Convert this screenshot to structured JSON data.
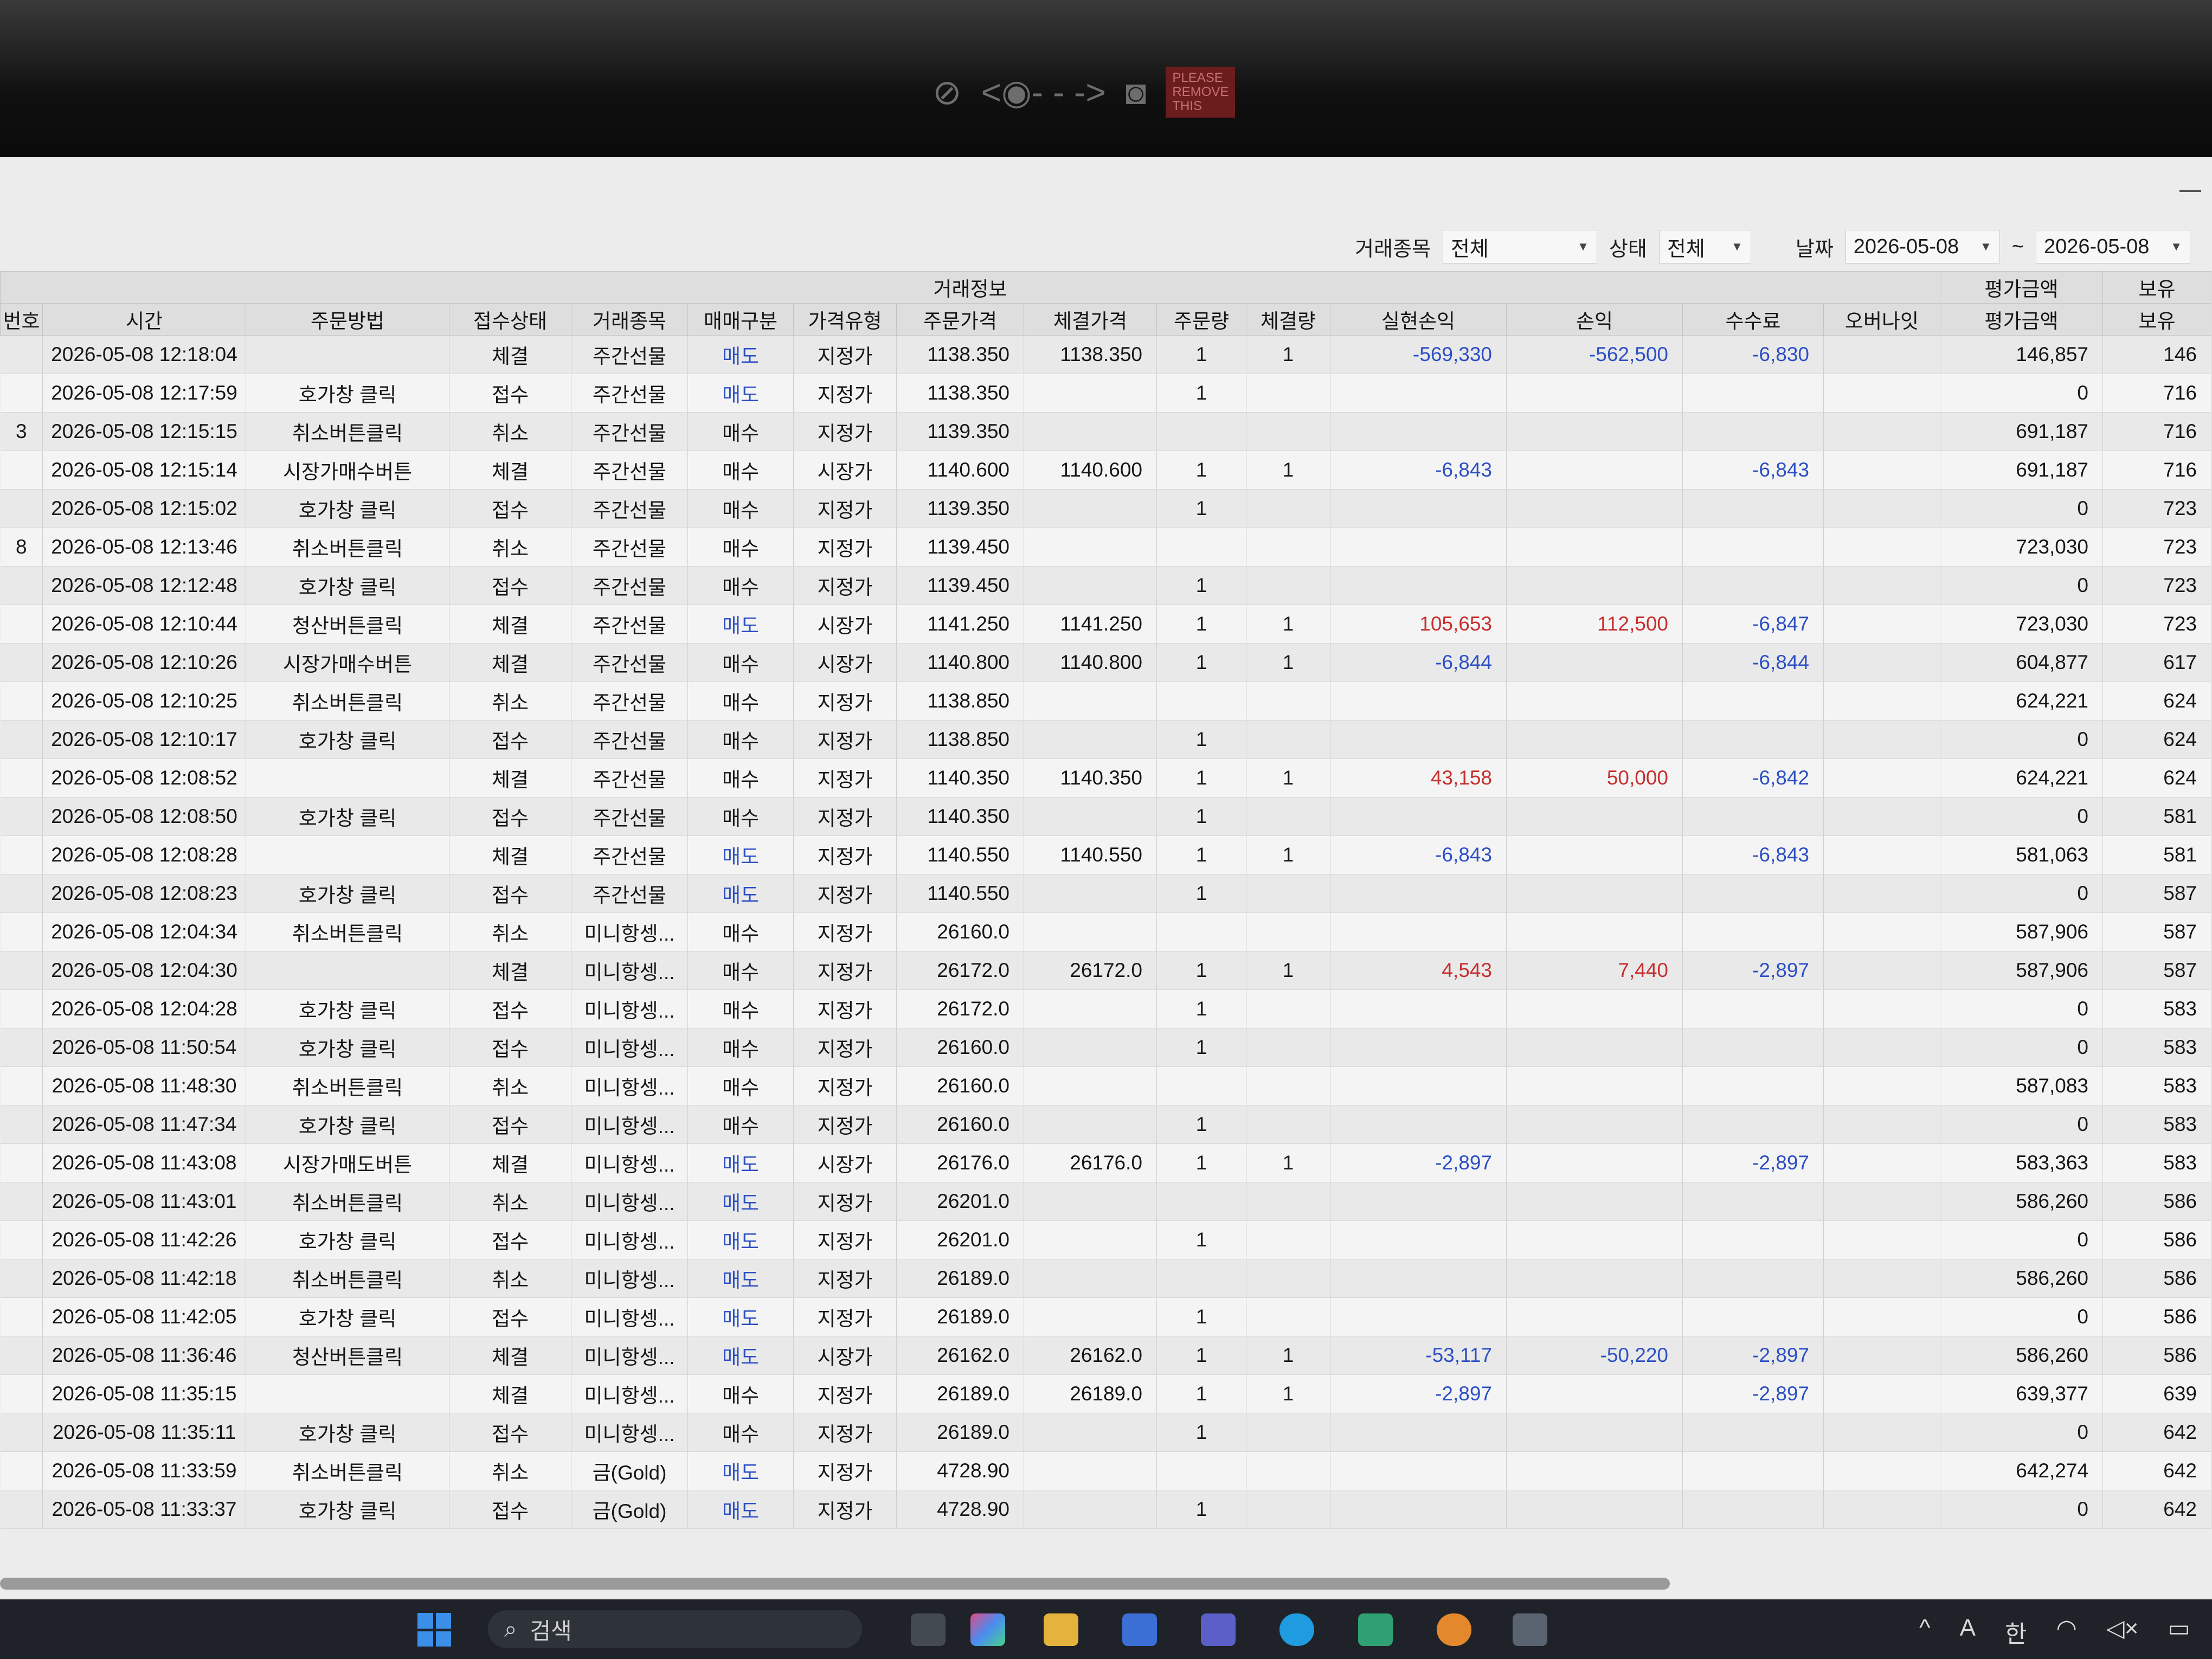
{
  "overlay": {
    "badge": "PLEASE\nREMOVE\nTHIS"
  },
  "filters": {
    "symbol_label": "거래종목",
    "symbol_value": "전체",
    "status_label": "상태",
    "status_value": "전체",
    "date_label": "날짜",
    "date_from": "2026-05-08",
    "date_sep": "~",
    "date_to": "2026-05-08"
  },
  "table": {
    "group_header": "거래정보",
    "right_group_header": "평가금액",
    "cut_group_header": "보유",
    "columns": [
      "번호",
      "시간",
      "주문방법",
      "접수상태",
      "거래종목",
      "매매구분",
      "가격유형",
      "주문가격",
      "체결가격",
      "주문량",
      "체결량",
      "실현손익",
      "손익",
      "수수료",
      "오버나잇",
      "평가금액",
      "보유"
    ],
    "rows": [
      [
        "",
        "2026-05-08 12:18:04",
        "",
        "체결",
        "주간선물",
        "매도",
        "지정가",
        "1138.350",
        "1138.350",
        "1",
        "1",
        "-569,330",
        "-562,500",
        "-6,830",
        "",
        "146,857",
        "146"
      ],
      [
        "",
        "2026-05-08 12:17:59",
        "호가창 클릭",
        "접수",
        "주간선물",
        "매도",
        "지정가",
        "1138.350",
        "",
        "1",
        "",
        "",
        "",
        "",
        "",
        "0",
        "716"
      ],
      [
        "3",
        "2026-05-08 12:15:15",
        "취소버튼클릭",
        "취소",
        "주간선물",
        "매수",
        "지정가",
        "1139.350",
        "",
        "",
        "",
        "",
        "",
        "",
        "",
        "691,187",
        "716"
      ],
      [
        "",
        "2026-05-08 12:15:14",
        "시장가매수버튼",
        "체결",
        "주간선물",
        "매수",
        "시장가",
        "1140.600",
        "1140.600",
        "1",
        "1",
        "-6,843",
        "",
        "-6,843",
        "",
        "691,187",
        "716"
      ],
      [
        "",
        "2026-05-08 12:15:02",
        "호가창 클릭",
        "접수",
        "주간선물",
        "매수",
        "지정가",
        "1139.350",
        "",
        "1",
        "",
        "",
        "",
        "",
        "",
        "0",
        "723"
      ],
      [
        "8",
        "2026-05-08 12:13:46",
        "취소버튼클릭",
        "취소",
        "주간선물",
        "매수",
        "지정가",
        "1139.450",
        "",
        "",
        "",
        "",
        "",
        "",
        "",
        "723,030",
        "723"
      ],
      [
        "",
        "2026-05-08 12:12:48",
        "호가창 클릭",
        "접수",
        "주간선물",
        "매수",
        "지정가",
        "1139.450",
        "",
        "1",
        "",
        "",
        "",
        "",
        "",
        "0",
        "723"
      ],
      [
        "",
        "2026-05-08 12:10:44",
        "청산버튼클릭",
        "체결",
        "주간선물",
        "매도",
        "시장가",
        "1141.250",
        "1141.250",
        "1",
        "1",
        "105,653",
        "112,500",
        "-6,847",
        "",
        "723,030",
        "723"
      ],
      [
        "",
        "2026-05-08 12:10:26",
        "시장가매수버튼",
        "체결",
        "주간선물",
        "매수",
        "시장가",
        "1140.800",
        "1140.800",
        "1",
        "1",
        "-6,844",
        "",
        "-6,844",
        "",
        "604,877",
        "617"
      ],
      [
        "",
        "2026-05-08 12:10:25",
        "취소버튼클릭",
        "취소",
        "주간선물",
        "매수",
        "지정가",
        "1138.850",
        "",
        "",
        "",
        "",
        "",
        "",
        "",
        "624,221",
        "624"
      ],
      [
        "",
        "2026-05-08 12:10:17",
        "호가창 클릭",
        "접수",
        "주간선물",
        "매수",
        "지정가",
        "1138.850",
        "",
        "1",
        "",
        "",
        "",
        "",
        "",
        "0",
        "624"
      ],
      [
        "",
        "2026-05-08 12:08:52",
        "",
        "체결",
        "주간선물",
        "매수",
        "지정가",
        "1140.350",
        "1140.350",
        "1",
        "1",
        "43,158",
        "50,000",
        "-6,842",
        "",
        "624,221",
        "624"
      ],
      [
        "",
        "2026-05-08 12:08:50",
        "호가창 클릭",
        "접수",
        "주간선물",
        "매수",
        "지정가",
        "1140.350",
        "",
        "1",
        "",
        "",
        "",
        "",
        "",
        "0",
        "581"
      ],
      [
        "",
        "2026-05-08 12:08:28",
        "",
        "체결",
        "주간선물",
        "매도",
        "지정가",
        "1140.550",
        "1140.550",
        "1",
        "1",
        "-6,843",
        "",
        "-6,843",
        "",
        "581,063",
        "581"
      ],
      [
        "",
        "2026-05-08 12:08:23",
        "호가창 클릭",
        "접수",
        "주간선물",
        "매도",
        "지정가",
        "1140.550",
        "",
        "1",
        "",
        "",
        "",
        "",
        "",
        "0",
        "587"
      ],
      [
        "",
        "2026-05-08 12:04:34",
        "취소버튼클릭",
        "취소",
        "미니항셍...",
        "매수",
        "지정가",
        "26160.0",
        "",
        "",
        "",
        "",
        "",
        "",
        "",
        "587,906",
        "587"
      ],
      [
        "",
        "2026-05-08 12:04:30",
        "",
        "체결",
        "미니항셍...",
        "매수",
        "지정가",
        "26172.0",
        "26172.0",
        "1",
        "1",
        "4,543",
        "7,440",
        "-2,897",
        "",
        "587,906",
        "587"
      ],
      [
        "",
        "2026-05-08 12:04:28",
        "호가창 클릭",
        "접수",
        "미니항셍...",
        "매수",
        "지정가",
        "26172.0",
        "",
        "1",
        "",
        "",
        "",
        "",
        "",
        "0",
        "583"
      ],
      [
        "",
        "2026-05-08 11:50:54",
        "호가창 클릭",
        "접수",
        "미니항셍...",
        "매수",
        "지정가",
        "26160.0",
        "",
        "1",
        "",
        "",
        "",
        "",
        "",
        "0",
        "583"
      ],
      [
        "",
        "2026-05-08 11:48:30",
        "취소버튼클릭",
        "취소",
        "미니항셍...",
        "매수",
        "지정가",
        "26160.0",
        "",
        "",
        "",
        "",
        "",
        "",
        "",
        "587,083",
        "583"
      ],
      [
        "",
        "2026-05-08 11:47:34",
        "호가창 클릭",
        "접수",
        "미니항셍...",
        "매수",
        "지정가",
        "26160.0",
        "",
        "1",
        "",
        "",
        "",
        "",
        "",
        "0",
        "583"
      ],
      [
        "",
        "2026-05-08 11:43:08",
        "시장가매도버튼",
        "체결",
        "미니항셍...",
        "매도",
        "시장가",
        "26176.0",
        "26176.0",
        "1",
        "1",
        "-2,897",
        "",
        "-2,897",
        "",
        "583,363",
        "583"
      ],
      [
        "",
        "2026-05-08 11:43:01",
        "취소버튼클릭",
        "취소",
        "미니항셍...",
        "매도",
        "지정가",
        "26201.0",
        "",
        "",
        "",
        "",
        "",
        "",
        "",
        "586,260",
        "586"
      ],
      [
        "",
        "2026-05-08 11:42:26",
        "호가창 클릭",
        "접수",
        "미니항셍...",
        "매도",
        "지정가",
        "26201.0",
        "",
        "1",
        "",
        "",
        "",
        "",
        "",
        "0",
        "586"
      ],
      [
        "",
        "2026-05-08 11:42:18",
        "취소버튼클릭",
        "취소",
        "미니항셍...",
        "매도",
        "지정가",
        "26189.0",
        "",
        "",
        "",
        "",
        "",
        "",
        "",
        "586,260",
        "586"
      ],
      [
        "",
        "2026-05-08 11:42:05",
        "호가창 클릭",
        "접수",
        "미니항셍...",
        "매도",
        "지정가",
        "26189.0",
        "",
        "1",
        "",
        "",
        "",
        "",
        "",
        "0",
        "586"
      ],
      [
        "",
        "2026-05-08 11:36:46",
        "청산버튼클릭",
        "체결",
        "미니항셍...",
        "매도",
        "시장가",
        "26162.0",
        "26162.0",
        "1",
        "1",
        "-53,117",
        "-50,220",
        "-2,897",
        "",
        "586,260",
        "586"
      ],
      [
        "",
        "2026-05-08 11:35:15",
        "",
        "체결",
        "미니항셍...",
        "매수",
        "지정가",
        "26189.0",
        "26189.0",
        "1",
        "1",
        "-2,897",
        "",
        "-2,897",
        "",
        "639,377",
        "639"
      ],
      [
        "",
        "2026-05-08 11:35:11",
        "호가창 클릭",
        "접수",
        "미니항셍...",
        "매수",
        "지정가",
        "26189.0",
        "",
        "1",
        "",
        "",
        "",
        "",
        "",
        "0",
        "642"
      ],
      [
        "",
        "2026-05-08 11:33:59",
        "취소버튼클릭",
        "취소",
        "금(Gold)",
        "매도",
        "지정가",
        "4728.90",
        "",
        "",
        "",
        "",
        "",
        "",
        "",
        "642,274",
        "642"
      ],
      [
        "",
        "2026-05-08 11:33:37",
        "호가창 클릭",
        "접수",
        "금(Gold)",
        "매도",
        "지정가",
        "4728.90",
        "",
        "1",
        "",
        "",
        "",
        "",
        "",
        "0",
        "642"
      ]
    ]
  },
  "taskbar": {
    "search_placeholder": "검색",
    "tray": {
      "chevron": "^",
      "font": "A",
      "lang": "한"
    }
  },
  "colors": {
    "negative": "#2c4fc4",
    "positive": "#c62e2e",
    "sell": "#2c4fc4"
  }
}
